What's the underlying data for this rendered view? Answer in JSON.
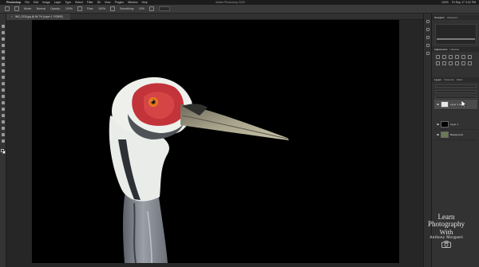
{
  "menubar": {
    "app_name": "Photoshop",
    "items": [
      "File",
      "Edit",
      "Image",
      "Layer",
      "Type",
      "Select",
      "Filter",
      "3D",
      "View",
      "Plugins",
      "Window",
      "Help"
    ],
    "window_title": "Adobe Photoshop 2023",
    "status": [
      "100%",
      "Fri Sep 17 3:22 PM"
    ]
  },
  "options_bar": {
    "items": [
      "Mode:",
      "Normal",
      "Opacity:",
      "100%",
      "Flow:",
      "100%",
      "Smoothing:",
      "10%"
    ]
  },
  "document_tab": {
    "title": "IMG_0234.jpg @ 66.7% (Layer 1, RGB/8*)"
  },
  "panels": {
    "top_tabs": [
      "Navigator",
      "Histogram"
    ],
    "adjust_tabs": [
      "Adjustments",
      "Libraries"
    ],
    "layer_tabs": [
      "Layers",
      "Channels",
      "Paths"
    ],
    "layers": [
      {
        "name": "Layer 1 copy",
        "selected": true
      },
      {
        "name": "Layer 1",
        "selected": false
      },
      {
        "name": "Background",
        "selected": false
      }
    ]
  },
  "watermark": {
    "line1": "Learn",
    "line2": "Photography",
    "line3": "With",
    "line4": "Anthony Morganti"
  },
  "colors": {
    "canvas": "#000000",
    "workspace": "#262626",
    "panel": "#323232",
    "bird_red": "#c2333a",
    "beak": "#8f8a73"
  }
}
